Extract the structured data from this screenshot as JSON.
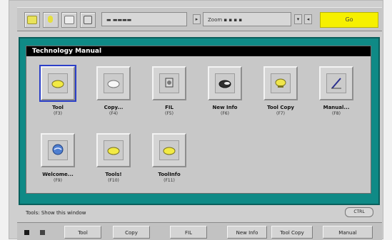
{
  "toolbar": {
    "field1": "▬ ▬▬▬▬",
    "field2": "Zoom ▪ ▪ ▪ ▪",
    "yellow_label": "Go"
  },
  "window": {
    "title": "Technology Manual"
  },
  "tiles": [
    {
      "label": "Tool",
      "sub": "(F3)",
      "icon": "yellow-blob-icon"
    },
    {
      "label": "Copy...",
      "sub": "(F4)",
      "icon": "white-blob-icon"
    },
    {
      "label": "FIL",
      "sub": "(F5)",
      "icon": "gear-icon"
    },
    {
      "label": "New Info",
      "sub": "(F6)",
      "icon": "dark-blob-icon"
    },
    {
      "label": "Tool Copy",
      "sub": "(F7)",
      "icon": "yellow-blob-icon"
    },
    {
      "label": "Manual...",
      "sub": "(F8)",
      "icon": "pen-icon"
    },
    {
      "label": "Welcome...",
      "sub": "(F9)",
      "icon": "globe-icon"
    },
    {
      "label": "Tools!",
      "sub": "(F10)",
      "icon": "yellow-blob-icon"
    },
    {
      "label": "ToolInfo",
      "sub": "(F11)",
      "icon": "yellow-blob-icon"
    }
  ],
  "status": {
    "text": "Tools: Show this window",
    "button": "CTRL"
  },
  "bottom": {
    "buttons": [
      "Tool",
      "Copy",
      "FIL",
      "New Info",
      "Tool Copy",
      "Manual"
    ]
  },
  "colors": {
    "teal": "#0f8a86",
    "select_outline": "#2c40c8",
    "yellow": "#f6f000"
  }
}
